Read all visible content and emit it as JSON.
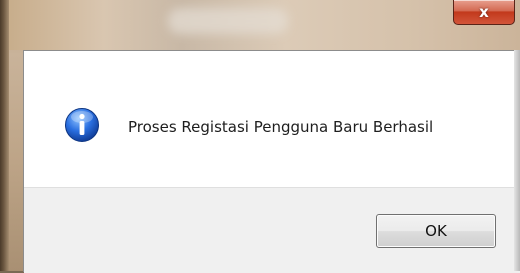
{
  "window": {
    "close_label": "x"
  },
  "dialog": {
    "icon": "info-icon",
    "message": "Proses Registasi Pengguna Baru Berhasil",
    "ok_label": "OK"
  },
  "colors": {
    "info_icon_blue": "#1f5fcf",
    "close_button_red": "#c2391c"
  }
}
